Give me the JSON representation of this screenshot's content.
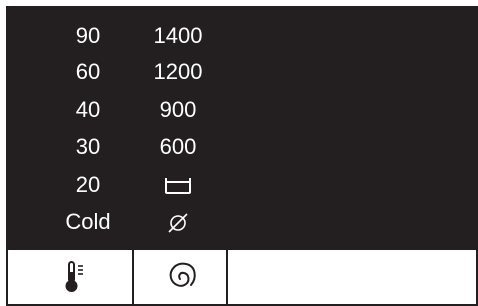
{
  "temperature_options": [
    "90",
    "60",
    "40",
    "30",
    "20",
    "Cold"
  ],
  "spin_options": [
    "1400",
    "1200",
    "900",
    "600"
  ],
  "spin_extra_icons": [
    "rinse-hold-icon",
    "no-spin-icon"
  ],
  "buttons": [
    {
      "icon": "thermometer-icon"
    },
    {
      "icon": "spin-spiral-icon"
    }
  ],
  "colors": {
    "display_background": "#231f20",
    "display_text": "#ffffff",
    "button_background": "#ffffff",
    "border": "#231f20"
  }
}
